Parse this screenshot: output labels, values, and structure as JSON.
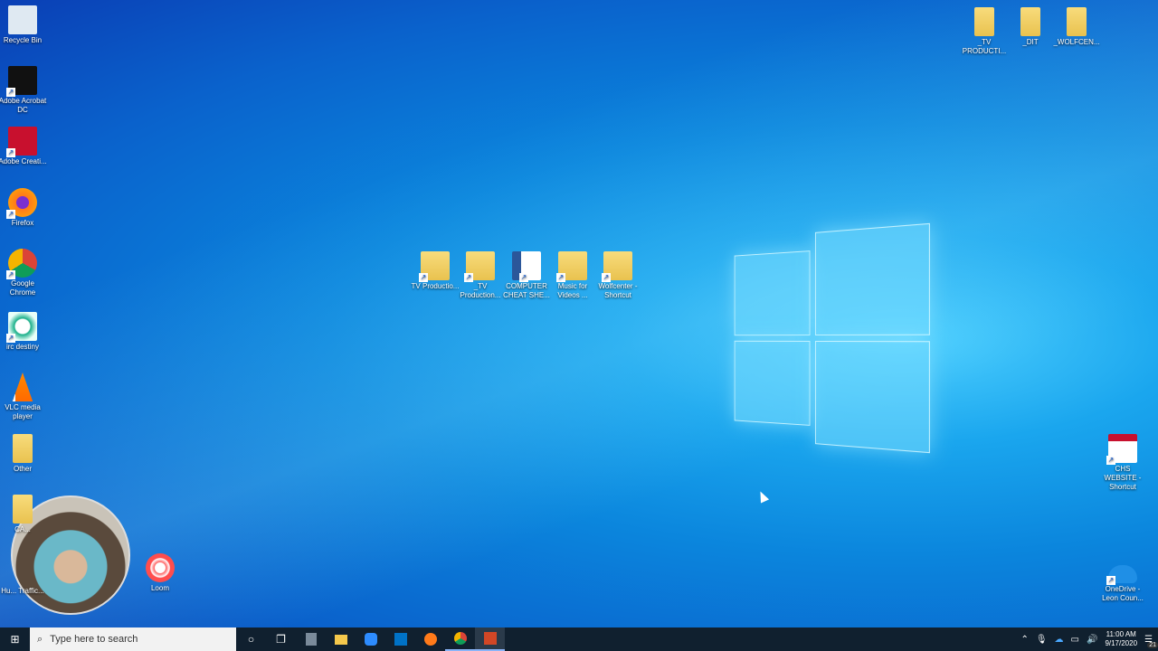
{
  "desktop": {
    "left_icons": [
      {
        "label": "Recycle Bin",
        "icon": "recycle-bin-icon"
      },
      {
        "label": "Adobe Acrobat DC",
        "icon": "acrobat-icon"
      },
      {
        "label": "Adobe Creati...",
        "icon": "creative-cloud-icon"
      },
      {
        "label": "Firefox",
        "icon": "firefox-icon"
      },
      {
        "label": "Google Chrome",
        "icon": "chrome-icon"
      },
      {
        "label": "irc destiny",
        "icon": "destiny-icon"
      },
      {
        "label": "VLC media player",
        "icon": "vlc-icon"
      },
      {
        "label": "Other",
        "icon": "folder-icon"
      },
      {
        "label": "CA...",
        "icon": "folder-icon"
      },
      {
        "label": "Hu... Traffic...",
        "icon": "file-icon"
      }
    ],
    "center_icons": [
      {
        "label": "TV Productio...",
        "icon": "pdf-folder-icon"
      },
      {
        "label": "_TV Production...",
        "icon": "folder-icon"
      },
      {
        "label": "COMPUTER CHEAT SHE...",
        "icon": "word-icon"
      },
      {
        "label": "Music for Videos ...",
        "icon": "folder-icon"
      },
      {
        "label": "Wolfcenter - Shortcut",
        "icon": "folder-icon"
      }
    ],
    "top_right_icons": [
      {
        "label": "_TV PRODUCTI...",
        "icon": "folder-icon"
      },
      {
        "label": "_DIT",
        "icon": "folder-icon"
      },
      {
        "label": "_WOLFCEN...",
        "icon": "folder-icon"
      }
    ],
    "right_icons": [
      {
        "label": "CHS WEBSITE - Shortcut",
        "icon": "website-icon"
      },
      {
        "label": "OneDrive - Leon Coun...",
        "icon": "onedrive-icon"
      }
    ],
    "loom": {
      "label": "Loom",
      "icon": "loom-icon"
    }
  },
  "taskbar": {
    "search_placeholder": "Type here to search",
    "apps": [
      "cortana",
      "task-view",
      "calculator",
      "file-explorer",
      "zoom",
      "outlook",
      "firefox",
      "chrome",
      "powerpoint"
    ],
    "time": "11:00 AM",
    "date": "9/17/2020",
    "notification_count": "21"
  }
}
